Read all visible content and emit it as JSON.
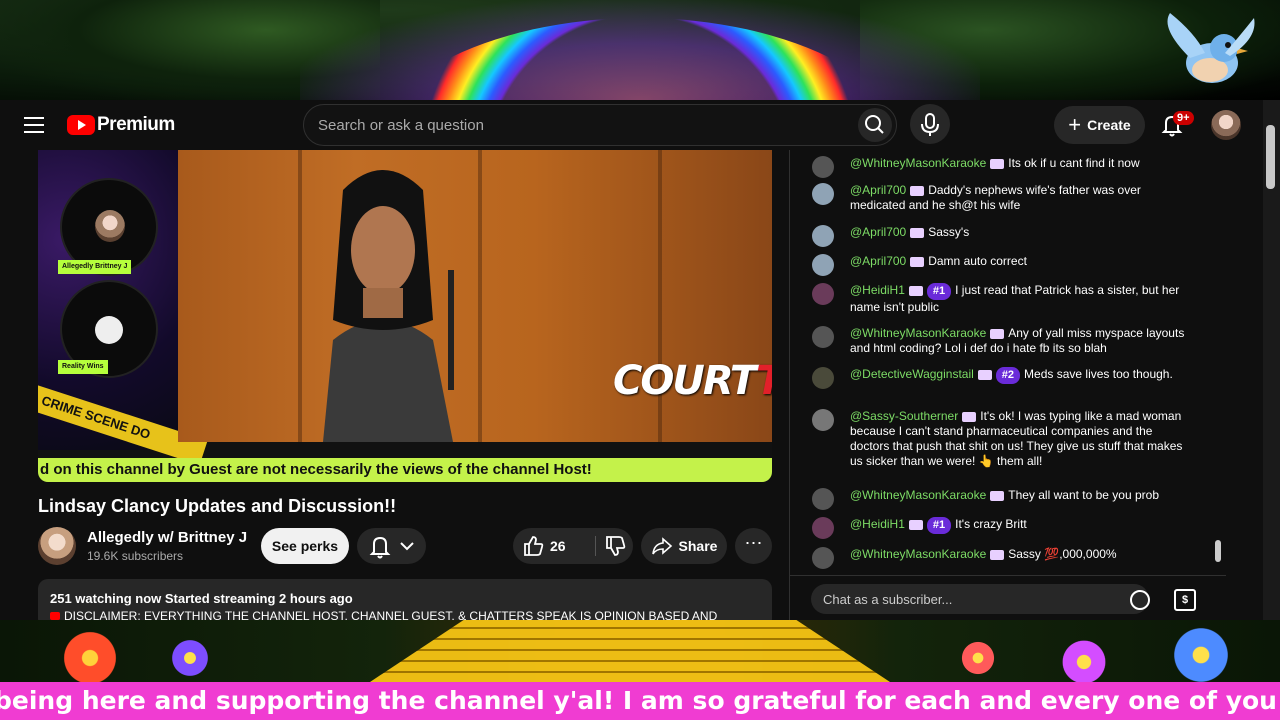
{
  "masthead": {
    "logo_text": "Premium",
    "search_placeholder": "Search or ask a question",
    "create_label": "Create",
    "notification_count": "9+"
  },
  "player": {
    "cam_label_1": "Allegedly Brittney J",
    "cam_label_2": "Reality Wins",
    "crime_tape_text": "CRIME SCENE DO",
    "court_logo_a": "COURT",
    "court_logo_b": "TV",
    "ticker_text": "d on this channel by Guest are not necessarily the views of the channel Host!"
  },
  "video": {
    "title": "Lindsay Clancy Updates and Discussion!!",
    "channel_name": "Allegedly w/ Brittney J",
    "subscribers": "19.6K subscribers",
    "perks_label": "See perks",
    "like_count": "26",
    "share_label": "Share",
    "watching": "251 watching now  Started streaming 2 hours ago",
    "description_snippet": "DISCLAIMER: EVERYTHING THE CHANNEL HOST, CHANNEL GUEST, & CHATTERS SPEAK IS OPINION BASED AND"
  },
  "chat": {
    "input_placeholder": "Chat as a subscriber...",
    "messages": [
      {
        "author": "@WhitneyMasonKaraoke",
        "rank": "",
        "text": "Its ok if u cant find it now",
        "avatar_color": "#555555"
      },
      {
        "author": "@April700",
        "rank": "",
        "text": "Daddy's nephews wife's father was over medicated and he sh@t his wife",
        "avatar_color": "#8fa3b5"
      },
      {
        "author": "@April700",
        "rank": "",
        "text": "Sassy's",
        "avatar_color": "#8fa3b5"
      },
      {
        "author": "@April700",
        "rank": "",
        "text": "Damn auto correct",
        "avatar_color": "#8fa3b5"
      },
      {
        "author": "@HeidiH1",
        "rank": "#1",
        "text": "I just read that Patrick has a sister, but her name isn't public",
        "avatar_color": "#6a3b5a"
      },
      {
        "author": "@WhitneyMasonKaraoke",
        "rank": "",
        "text": "Any of yall miss myspace layouts and html coding? Lol i def do i hate fb its so blah",
        "avatar_color": "#555555"
      },
      {
        "author": "@DetectiveWagginstail",
        "rank": "#2",
        "text": "Meds save lives too though.",
        "avatar_color": "#4a4a3a"
      },
      {
        "author": "@Sassy-Southerner",
        "rank": "",
        "text": "It's ok! I was typing like a mad woman because I can't stand pharmaceutical companies and the doctors that push that shit on us! They give us stuff that makes us sicker than we were! 👆 them all!",
        "avatar_color": "#777777"
      },
      {
        "author": "@WhitneyMasonKaraoke",
        "rank": "",
        "text": "They all want to be you prob",
        "avatar_color": "#555555"
      },
      {
        "author": "@HeidiH1",
        "rank": "#1",
        "text": "It's crazy Britt",
        "avatar_color": "#6a3b5a"
      },
      {
        "author": "@WhitneyMasonKaraoke",
        "rank": "",
        "text": "Sassy 💯,000,000%",
        "avatar_color": "#555555"
      }
    ]
  },
  "bottom_ticker": "being here and supporting the channel y'al! I am so grateful for each and every one of you bloody w",
  "colors": {
    "ticker_pink": "#f03cd2",
    "player_ticker_green": "#c4f24a",
    "chat_author_green": "#7ddc66",
    "rank_purple": "#6a2bd9",
    "yt_red": "#ff0000"
  }
}
